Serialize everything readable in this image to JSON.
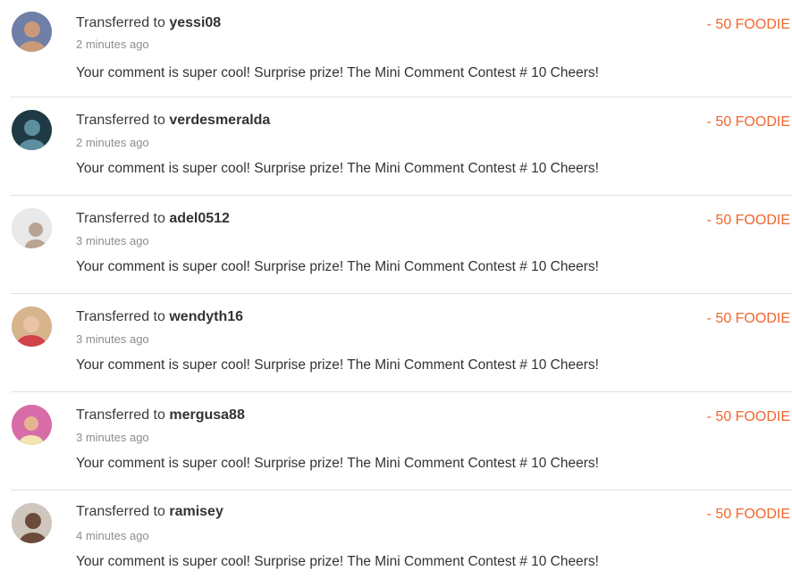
{
  "transfers": [
    {
      "prefix": "Transferred to ",
      "username": "yessi08",
      "time": "2 minutes ago",
      "message": "Your comment is super cool! Surprise prize! The Mini Comment Contest # 10 Cheers!",
      "amount": "- 50 FOODIE",
      "avatar_bg": "#6f7fa8",
      "avatar_fg": "#c99a7a"
    },
    {
      "prefix": "Transferred to ",
      "username": "verdesmeralda",
      "time": "2 minutes ago",
      "message": "Your comment is super cool! Surprise prize! The Mini Comment Contest # 10 Cheers!",
      "amount": "- 50 FOODIE",
      "avatar_bg": "#1f3a44",
      "avatar_fg": "#5b8fa0"
    },
    {
      "prefix": "Transferred to ",
      "username": "adel0512",
      "time": "3 minutes ago",
      "message": "Your comment is super cool! Surprise prize! The Mini Comment Contest # 10 Cheers!",
      "amount": "- 50 FOODIE",
      "avatar_bg": "#e9e9e9",
      "avatar_fg": "#b9a393"
    },
    {
      "prefix": "Transferred to ",
      "username": "wendyth16",
      "time": "3 minutes ago",
      "message": "Your comment is super cool! Surprise prize! The Mini Comment Contest # 10 Cheers!",
      "amount": "- 50 FOODIE",
      "avatar_bg": "#d8b48c",
      "avatar_fg": "#d2424a"
    },
    {
      "prefix": "Transferred to ",
      "username": "mergusa88",
      "time": "3 minutes ago",
      "message": "Your comment is super cool! Surprise prize! The Mini Comment Contest # 10 Cheers!",
      "amount": "- 50 FOODIE",
      "avatar_bg": "#d86ca9",
      "avatar_fg": "#e7b493"
    },
    {
      "prefix": "Transferred to ",
      "username": "ramisey",
      "time": "4 minutes ago",
      "message": "Your comment is super cool! Surprise prize! The Mini Comment Contest # 10 Cheers!",
      "amount": "- 50 FOODIE",
      "avatar_bg": "#cfc6bd",
      "avatar_fg": "#6b4b3a"
    }
  ]
}
